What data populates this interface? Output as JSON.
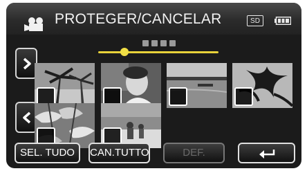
{
  "header": {
    "title": "PROTEGER/CANCELAR",
    "mode_icon": "video-camera-icon",
    "storage_badge": "SD",
    "battery_icon": "battery-full-icon"
  },
  "pager": {
    "page_indicator_icon": "page-dots-icon",
    "position": 0.22
  },
  "navigation": {
    "next_icon": "chevron-right-icon",
    "prev_icon": "chevron-left-icon"
  },
  "thumbnails": [
    {
      "selected": false
    },
    {
      "selected": false
    },
    {
      "selected": false
    },
    {
      "selected": false
    },
    {
      "selected": false
    },
    {
      "selected": false
    }
  ],
  "buttons": {
    "select_all": "SEL. TUDO",
    "cancel_all": "CAN.TUTTO",
    "set": "DEF.",
    "back_icon": "return-arrow-icon"
  },
  "colors": {
    "accent": "#e8d23a",
    "background": "#1b1b1b",
    "disabled_text": "#6a6a6a"
  }
}
